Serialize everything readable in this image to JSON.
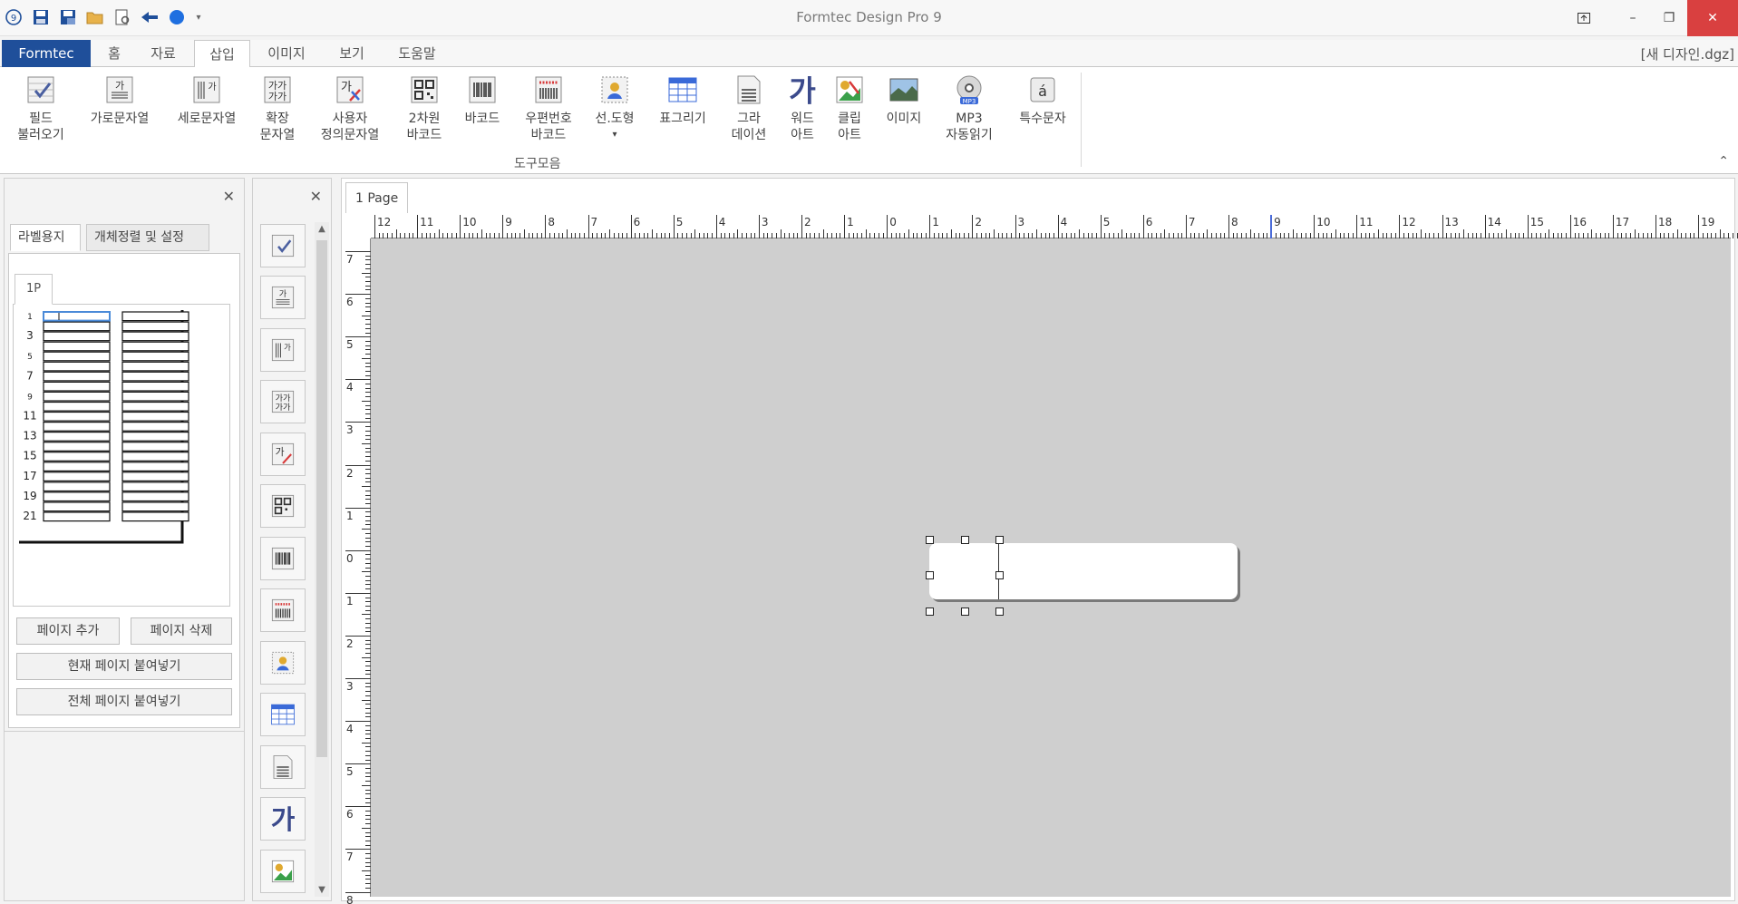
{
  "window": {
    "title": "Formtec Design Pro 9",
    "doc_name": "[새 디자인.dgz]",
    "controls": {
      "minimize": "–",
      "restore": "❐",
      "close": "✕"
    }
  },
  "ribbon_tabs": [
    {
      "label": "Formtec"
    },
    {
      "label": "홈"
    },
    {
      "label": "자료"
    },
    {
      "label": "삽입"
    },
    {
      "label": "이미지"
    },
    {
      "label": "보기"
    },
    {
      "label": "도움말"
    }
  ],
  "ribbon": {
    "group_label": "도구모음",
    "buttons": [
      {
        "line1": "필드",
        "line2": "불러오기"
      },
      {
        "line1": "가로문자열",
        "line2": ""
      },
      {
        "line1": "세로문자열",
        "line2": ""
      },
      {
        "line1": "확장",
        "line2": "문자열"
      },
      {
        "line1": "사용자",
        "line2": "정의문자열"
      },
      {
        "line1": "2차원",
        "line2": "바코드"
      },
      {
        "line1": "바코드",
        "line2": ""
      },
      {
        "line1": "우편번호",
        "line2": "바코드"
      },
      {
        "line1": "선.도형",
        "line2": "▾"
      },
      {
        "line1": "표그리기",
        "line2": ""
      },
      {
        "line1": "그라",
        "line2": "데이션"
      },
      {
        "line1": "워드",
        "line2": "아트"
      },
      {
        "line1": "클립",
        "line2": "아트"
      },
      {
        "line1": "이미지",
        "line2": ""
      },
      {
        "line1": "MP3",
        "line2": "자동읽기"
      },
      {
        "line1": "특수문자",
        "line2": ""
      }
    ]
  },
  "left_panel": {
    "tabs": [
      "라벨용지",
      "개체정렬 및 설정"
    ],
    "page_tab": "1P",
    "row_numbers": [
      "1",
      "3",
      "5",
      "7",
      "9",
      "11",
      "13",
      "15",
      "17",
      "19",
      "21"
    ],
    "buttons": {
      "add_page": "페이지 추가",
      "delete_page": "페이지 삭제",
      "paste_current": "현재 페이지 붙여넣기",
      "paste_all": "전체 페이지 붙여넣기"
    }
  },
  "canvas": {
    "page_tab": "1 Page",
    "ruler_top": [
      "12",
      "11",
      "10",
      "9",
      "8",
      "7",
      "6",
      "5",
      "4",
      "3",
      "2",
      "1",
      "0",
      "1",
      "2",
      "3",
      "4",
      "5",
      "6",
      "7",
      "8",
      "9",
      "10",
      "11",
      "12",
      "13",
      "14",
      "15",
      "16",
      "17",
      "18",
      "19"
    ],
    "ruler_left": [
      "7",
      "6",
      "5",
      "4",
      "3",
      "2",
      "1",
      "0",
      "1",
      "2",
      "3",
      "4",
      "5",
      "6",
      "7",
      "8"
    ]
  }
}
